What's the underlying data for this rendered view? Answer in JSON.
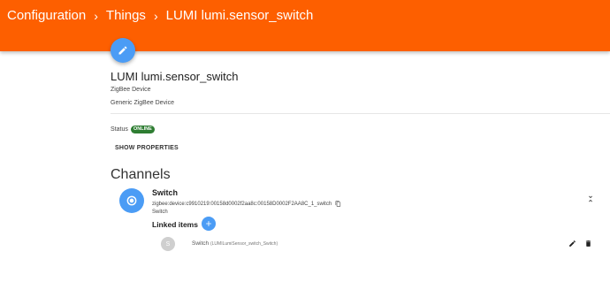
{
  "breadcrumb": {
    "items": [
      "Configuration",
      "Things",
      "LUMI lumi.sensor_switch"
    ],
    "separator": "›"
  },
  "thing": {
    "label": "LUMI lumi.sensor_switch",
    "type_line1": "ZigBee Device",
    "type_line2": "Generic ZigBee Device",
    "status_label": "Status",
    "status_value": "ONLINE",
    "show_properties_label": "SHOW PROPERTIES"
  },
  "channels": {
    "heading": "Channels",
    "items": [
      {
        "name": "Switch",
        "uid": "zigbee:device:c9910219:00158d0002f2aa8c:00158D0002F2AA8C_1_switch",
        "type": "Switch",
        "linked_items_label": "Linked items",
        "linked_items": [
          {
            "avatar": "S",
            "label": "Switch",
            "item_name": "(LUMILumiSensor_switch_Switch)"
          }
        ]
      }
    ]
  },
  "colors": {
    "header": "#fd5f00",
    "accent": "#4b9cf5",
    "online": "#2e7d32"
  },
  "icons": [
    "pencil-icon",
    "radio-button-icon",
    "copy-icon",
    "collapse-icon",
    "plus-icon",
    "edit-icon",
    "delete-icon"
  ]
}
